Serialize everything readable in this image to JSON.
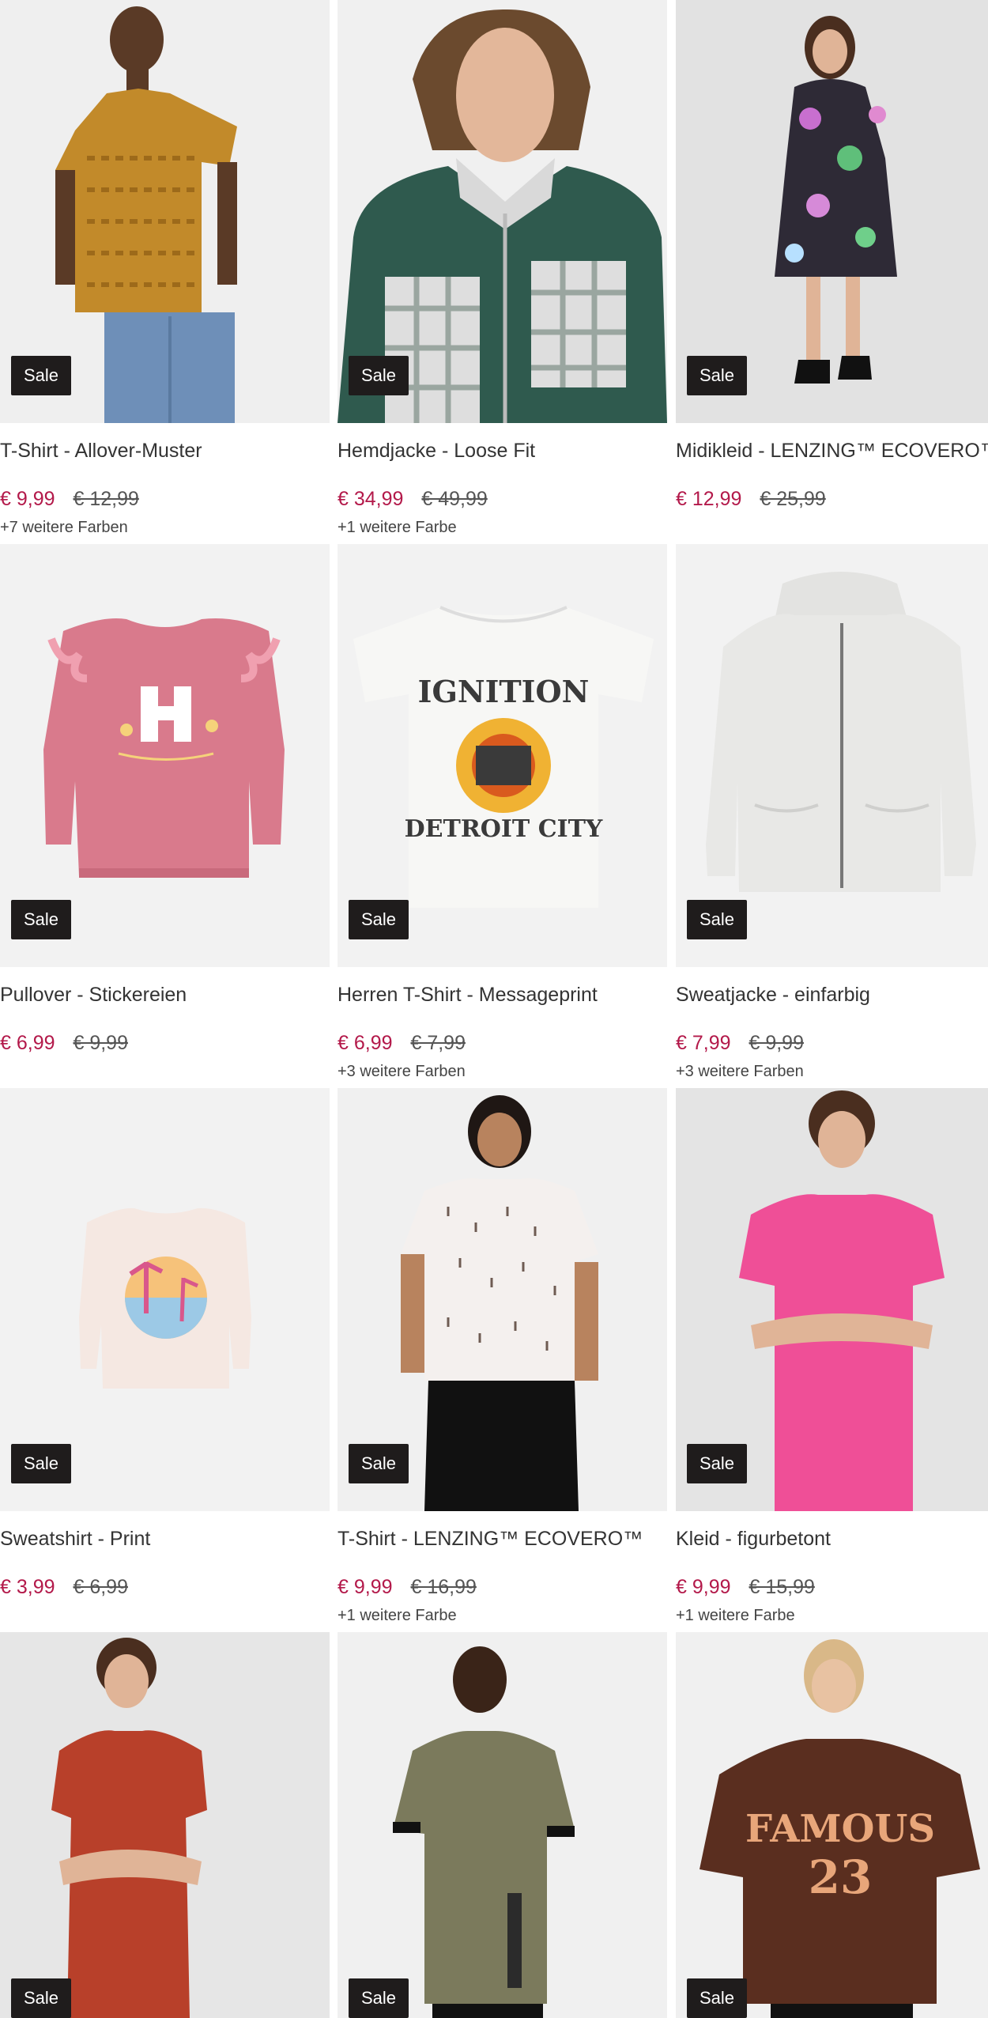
{
  "products": [
    {
      "title": "T-Shirt - Allover-Muster",
      "price": "€ 9,99",
      "old_price": "€ 12,99",
      "colors": "+7 weitere Farben",
      "badge": "Sale",
      "icon": "mens-patterned-tshirt"
    },
    {
      "title": "Hemdjacke - Loose Fit",
      "price": "€ 34,99",
      "old_price": "€ 49,99",
      "colors": "+1 weitere Farbe",
      "badge": "Sale",
      "icon": "plaid-shirt-jacket"
    },
    {
      "title": "Midikleid - LENZING™ ECOVERO™",
      "price": "€ 12,99",
      "old_price": "€ 25,99",
      "colors": "",
      "badge": "Sale",
      "icon": "floral-dress"
    },
    {
      "title": "Pullover - Stickereien",
      "price": "€ 6,99",
      "old_price": "€ 9,99",
      "colors": "",
      "badge": "Sale",
      "icon": "pink-pullover"
    },
    {
      "title": "Herren T-Shirt - Messageprint",
      "price": "€ 6,99",
      "old_price": "€ 7,99",
      "colors": "+3 weitere Farben",
      "badge": "Sale",
      "icon": "white-print-tshirt"
    },
    {
      "title": "Sweatjacke - einfarbig",
      "price": "€ 7,99",
      "old_price": "€ 9,99",
      "colors": "+3 weitere Farben",
      "badge": "Sale",
      "icon": "grey-zip-hoodie"
    },
    {
      "title": "Sweatshirt - Print",
      "price": "€ 3,99",
      "old_price": "€ 6,99",
      "colors": "",
      "badge": "Sale",
      "icon": "kids-sweatshirt"
    },
    {
      "title": "T-Shirt - LENZING™ ECOVERO™",
      "price": "€ 9,99",
      "old_price": "€ 16,99",
      "colors": "+1 weitere Farbe",
      "badge": "Sale",
      "icon": "white-dotted-tshirt"
    },
    {
      "title": "Kleid - figurbetont",
      "price": "€ 9,99",
      "old_price": "€ 15,99",
      "colors": "+1 weitere Farbe",
      "badge": "Sale",
      "icon": "pink-fitted-dress"
    },
    {
      "title": "",
      "price": "",
      "old_price": "",
      "colors": "",
      "badge": "Sale",
      "icon": "red-tshirt-dress"
    },
    {
      "title": "",
      "price": "",
      "old_price": "",
      "colors": "",
      "badge": "Sale",
      "icon": "olive-mens-tshirt"
    },
    {
      "title": "",
      "price": "",
      "old_price": "",
      "colors": "",
      "badge": "Sale",
      "icon": "brown-famous-tshirt"
    }
  ],
  "colors": {
    "sale_price": "#b3194a",
    "badge_bg": "#1f1c1c",
    "image_bg": "#f2f2f2"
  },
  "print_texts": {
    "famous": "FAMOUS",
    "number": "23",
    "ignition": "IGNITION",
    "detroit": "DETROIT CITY"
  }
}
